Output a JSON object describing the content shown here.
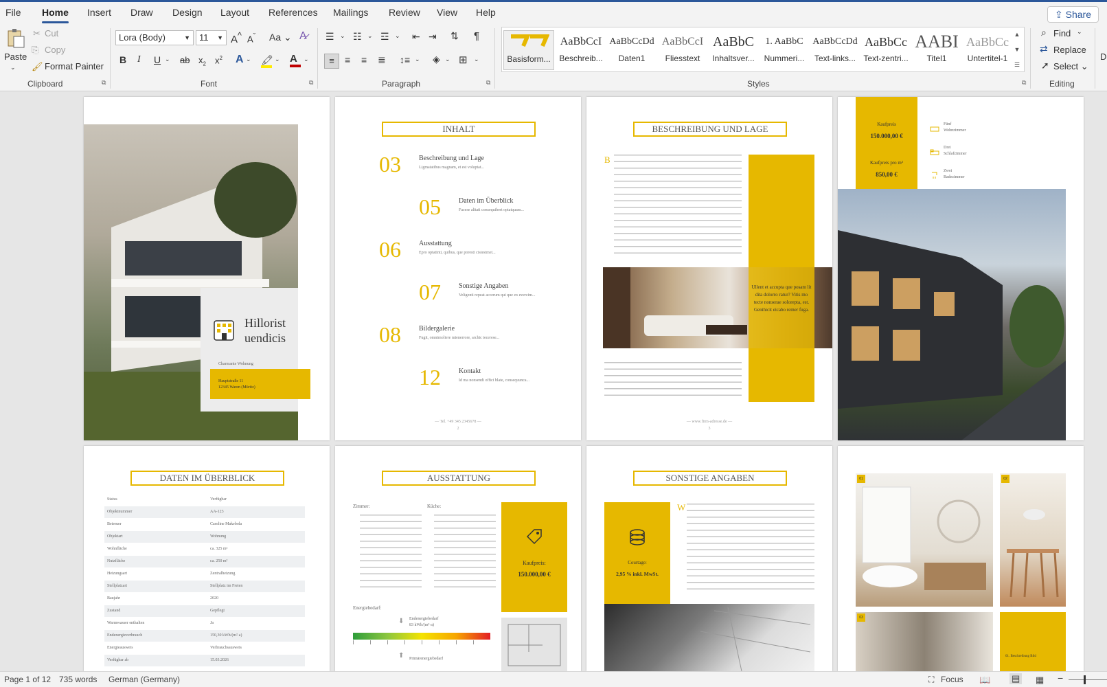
{
  "tabs": [
    "File",
    "Home",
    "Insert",
    "Draw",
    "Design",
    "Layout",
    "References",
    "Mailings",
    "Review",
    "View",
    "Help"
  ],
  "share": "Share",
  "clipboard": {
    "paste": "Paste",
    "cut": "Cut",
    "copy": "Copy",
    "format_painter": "Format Painter",
    "label": "Clipboard"
  },
  "font": {
    "name": "Lora (Body)",
    "size": "11",
    "label": "Font",
    "grow": "A",
    "shrink": "A",
    "case": "Aa",
    "bold": "B",
    "italic": "I",
    "underline": "U",
    "strike": "ab",
    "sub": "x",
    "sup": "x"
  },
  "paragraph": {
    "label": "Paragraph",
    "pilcrow": "¶"
  },
  "styles": {
    "label": "Styles",
    "items": [
      {
        "preview": "",
        "name": "Basisform..."
      },
      {
        "preview": "AaBbCcI",
        "name": "Beschreib..."
      },
      {
        "preview": "AaBbCcDd",
        "name": "Daten1"
      },
      {
        "preview": "AaBbCcI",
        "name": "Fliesstext"
      },
      {
        "preview": "AaBbC",
        "name": "Inhaltsver..."
      },
      {
        "preview": "1. AaBbC",
        "name": "Nummeri..."
      },
      {
        "preview": "AaBbCcDd",
        "name": "Text-links..."
      },
      {
        "preview": "AaBbCc",
        "name": "Text-zentri..."
      },
      {
        "preview": "AABI",
        "name": "Titel1"
      },
      {
        "preview": "AaBbCc",
        "name": "Untertitel-1"
      }
    ]
  },
  "editing": {
    "label": "Editing",
    "find": "Find",
    "replace": "Replace",
    "select": "Select"
  },
  "editing_extra": "D",
  "doc": {
    "cover": {
      "title1": "Hillorist",
      "title2": "uendicis",
      "subtitle": "Charmante Wohnung",
      "addr1": "Hauptstraße 11",
      "addr2": "12345 Waren (Müritz)"
    },
    "toc": {
      "title": "INHALT",
      "items": [
        {
          "num": "03",
          "title": "Beschreibung und Lage",
          "sub": "Ligmatatibus magnam, et est voluptat..."
        },
        {
          "num": "05",
          "title": "Daten im Überblick",
          "sub": "Facese alitati consequibert optatquam..."
        },
        {
          "num": "06",
          "title": "Ausstattung",
          "sub": "Epro optatinti, quibus, que poresti cistestmet..."
        },
        {
          "num": "07",
          "title": "Sonstige Angaben",
          "sub": "Veligenti repeat accerum qui que ex evercim..."
        },
        {
          "num": "08",
          "title": "Bildergalerie",
          "sub": "Fugit, omnimoliere mienerrore, archic tecerese..."
        },
        {
          "num": "12",
          "title": "Kontakt",
          "sub": "Id ma nonsendi offici blate, consequunca..."
        }
      ],
      "footer": "— Tel. +49 345 2345678 —",
      "pagenum": "2"
    },
    "desc": {
      "title": "BESCHREIBUNG UND LAGE",
      "dropcap": "B",
      "quote": "Ullent et accupta que posam lit dita dolorro ratur? Vitis mo tecte nonserae solorepta, est. Genihicit eicabo remer fuga.",
      "footer": "— www.firm-adresse.de —",
      "pagenum": "3"
    },
    "price": {
      "label1": "Kaufpreis",
      "value1": "150.000,00 €",
      "label2": "Kaufpreis pro m²",
      "value2": "850,00 €",
      "rooms": [
        [
          "Fünf",
          "Wohnzimmer"
        ],
        [
          "Drei",
          "Schlafzimmer"
        ],
        [
          "Zwei",
          "Badezimmer"
        ]
      ]
    },
    "data": {
      "title": "DATEN IM ÜBERBLICK",
      "rows": [
        [
          "Status",
          "Verfügbar"
        ],
        [
          "Objektnummer",
          "AA-123"
        ],
        [
          "Betreuer",
          "Caroline Makebola"
        ],
        [
          "Objektart",
          "Wohnung"
        ],
        [
          "Wohnfläche",
          "ca. 325 m²"
        ],
        [
          "Nutzfläche",
          "ca. 250 m²"
        ],
        [
          "Heizungsart",
          "Zentralheizung"
        ],
        [
          "Stellplatzart",
          "Stellplatz im Freien"
        ],
        [
          "Baujahr",
          "2020"
        ],
        [
          "Zustand",
          "Gepflegt"
        ],
        [
          "Warmwasser enthalten",
          "Ja"
        ],
        [
          "Endenergieverbrauch",
          "150,30 kWh/(m²·a)"
        ],
        [
          "Energieausweis",
          "Verbrauchsausweis"
        ],
        [
          "Verfügbar ab",
          "15.03.2026"
        ]
      ]
    },
    "equip": {
      "title": "AUSSTATTUNG",
      "col1": "Zimmer:",
      "col2": "Küche:",
      "price_label": "Kaufpreis:",
      "price": "150.000,00 €",
      "energy_title": "Energiebedarf:",
      "energy_end": "Endenergiebedarf",
      "energy_val": "83 kWh/(m²·a)",
      "energy_prim": "Primärenergiebedarf"
    },
    "other": {
      "title": "SONSTIGE ANGABEN",
      "dropcap": "W",
      "courtage_label": "Courtage:",
      "courtage": "2,95 % inkl. MwSt."
    },
    "gallery": {
      "tags": [
        "01",
        "02",
        "03"
      ],
      "caption": "01. Beschreibung Bild"
    }
  },
  "statusbar": {
    "page": "Page 1 of 12",
    "words": "735 words",
    "lang": "German (Germany)",
    "focus": "Focus"
  },
  "colors": {
    "accent": "#e6b800",
    "ribbon_blue": "#2b579a"
  }
}
